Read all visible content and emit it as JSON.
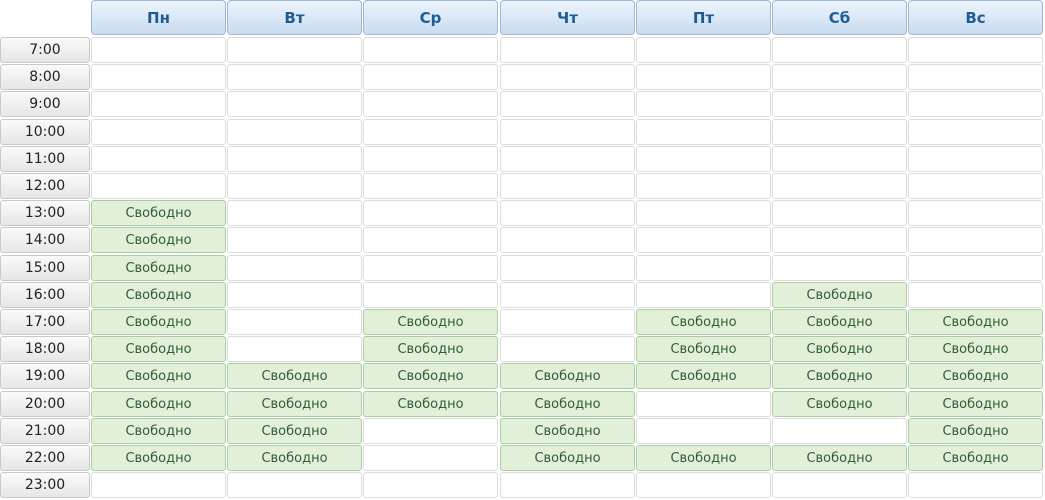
{
  "days": [
    "Пн",
    "Вт",
    "Ср",
    "Чт",
    "Пт",
    "Сб",
    "Вс"
  ],
  "times": [
    "7:00",
    "8:00",
    "9:00",
    "10:00",
    "11:00",
    "12:00",
    "13:00",
    "14:00",
    "15:00",
    "16:00",
    "17:00",
    "18:00",
    "19:00",
    "20:00",
    "21:00",
    "22:00",
    "23:00"
  ],
  "free_label": "Свободно",
  "colors": {
    "header_text": "#1f5c93",
    "free_bg": "#e2efd9",
    "free_border": "#a9cfa3"
  },
  "schedule": [
    [
      0,
      0,
      0,
      0,
      0,
      0,
      0
    ],
    [
      0,
      0,
      0,
      0,
      0,
      0,
      0
    ],
    [
      0,
      0,
      0,
      0,
      0,
      0,
      0
    ],
    [
      0,
      0,
      0,
      0,
      0,
      0,
      0
    ],
    [
      0,
      0,
      0,
      0,
      0,
      0,
      0
    ],
    [
      0,
      0,
      0,
      0,
      0,
      0,
      0
    ],
    [
      1,
      0,
      0,
      0,
      0,
      0,
      0
    ],
    [
      1,
      0,
      0,
      0,
      0,
      0,
      0
    ],
    [
      1,
      0,
      0,
      0,
      0,
      0,
      0
    ],
    [
      1,
      0,
      0,
      0,
      0,
      1,
      0
    ],
    [
      1,
      0,
      1,
      0,
      1,
      1,
      1
    ],
    [
      1,
      0,
      1,
      0,
      1,
      1,
      1
    ],
    [
      1,
      1,
      1,
      1,
      1,
      1,
      1
    ],
    [
      1,
      1,
      1,
      1,
      0,
      1,
      1
    ],
    [
      1,
      1,
      0,
      1,
      0,
      0,
      1
    ],
    [
      1,
      1,
      0,
      1,
      1,
      1,
      1
    ],
    [
      0,
      0,
      0,
      0,
      0,
      0,
      0
    ]
  ]
}
